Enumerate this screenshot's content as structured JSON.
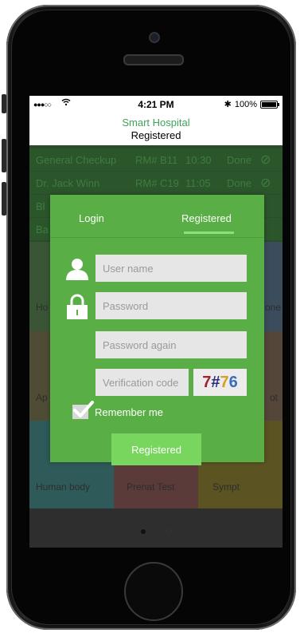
{
  "status_bar": {
    "signal": "●●●○○",
    "time": "4:21 PM",
    "bluetooth": "✱",
    "battery": "100%"
  },
  "nav": {
    "title": "Smart Hospital",
    "subtitle": "Registered"
  },
  "background": {
    "rows": [
      {
        "name": "General Checkup",
        "room": "RM# B11",
        "time": "10:30",
        "status": "Done"
      },
      {
        "name": "Dr. Jack Winn",
        "room": "RM# C19",
        "time": "11:05",
        "status": "Done"
      }
    ],
    "partials": [
      "Bl",
      "Ba"
    ],
    "tiles": [
      "Ho",
      "one",
      "Ap",
      "ot",
      "Human body",
      "Prenat Test",
      "Sympt"
    ]
  },
  "dialog": {
    "tabs": {
      "login": "Login",
      "registered": "Registered"
    },
    "fields": {
      "username_placeholder": "User name",
      "password_placeholder": "Password",
      "password_again_placeholder": "Password again",
      "verification_placeholder": "Verification code"
    },
    "captcha": {
      "c1": "7",
      "c2": "#",
      "c3": "7",
      "c4": "6"
    },
    "remember_label": "Remember me",
    "submit_label": "Registered"
  },
  "colors": {
    "accent": "#5aae46",
    "button": "#78d65f",
    "title": "#3fa35a"
  }
}
